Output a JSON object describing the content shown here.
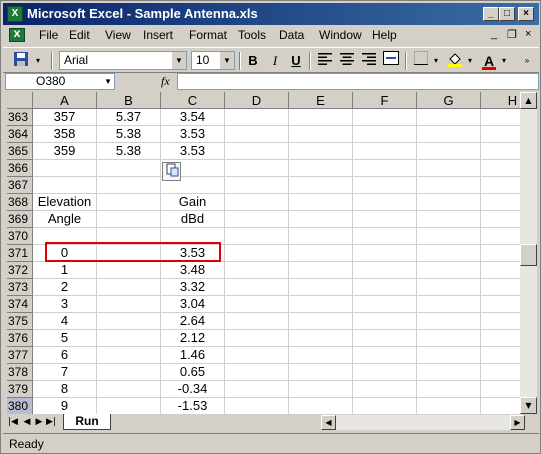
{
  "window": {
    "title": "Microsoft Excel - Sample Antenna.xls",
    "icon": "excel-app-icon",
    "controls": [
      "_",
      "□",
      "×"
    ]
  },
  "menu": {
    "items": [
      "File",
      "Edit",
      "View",
      "Insert",
      "Format",
      "Tools",
      "Data",
      "Window",
      "Help"
    ],
    "right_controls": [
      "_",
      "❐",
      "×"
    ]
  },
  "toolbar": {
    "font_name": "Arial",
    "font_size": "10",
    "bold": "B",
    "italic": "I",
    "underline": "U",
    "font_color_letter": "A"
  },
  "formula_bar": {
    "name_box": "O380",
    "fx": "fx",
    "value": ""
  },
  "grid": {
    "columns": [
      "A",
      "B",
      "C",
      "D",
      "E",
      "F",
      "G",
      "H"
    ],
    "rows": [
      {
        "num": "363",
        "A": "357",
        "B": "5.37",
        "C": "3.54"
      },
      {
        "num": "364",
        "A": "358",
        "B": "5.38",
        "C": "3.53"
      },
      {
        "num": "365",
        "A": "359",
        "B": "5.38",
        "C": "3.53"
      },
      {
        "num": "366",
        "A": "",
        "B": "",
        "C": ""
      },
      {
        "num": "367",
        "A": "",
        "B": "",
        "C": ""
      },
      {
        "num": "368",
        "A": "Elevation",
        "B": "",
        "C": "Gain"
      },
      {
        "num": "369",
        "A": "Angle",
        "B": "",
        "C": "dBd"
      },
      {
        "num": "370",
        "A": "",
        "B": "",
        "C": ""
      },
      {
        "num": "371",
        "A": "0",
        "B": "",
        "C": "3.53"
      },
      {
        "num": "372",
        "A": "1",
        "B": "",
        "C": "3.48"
      },
      {
        "num": "373",
        "A": "2",
        "B": "",
        "C": "3.32"
      },
      {
        "num": "374",
        "A": "3",
        "B": "",
        "C": "3.04"
      },
      {
        "num": "375",
        "A": "4",
        "B": "",
        "C": "2.64"
      },
      {
        "num": "376",
        "A": "5",
        "B": "",
        "C": "2.12"
      },
      {
        "num": "377",
        "A": "6",
        "B": "",
        "C": "1.46"
      },
      {
        "num": "378",
        "A": "7",
        "B": "",
        "C": "0.65"
      },
      {
        "num": "379",
        "A": "8",
        "B": "",
        "C": "-0.34"
      },
      {
        "num": "380",
        "A": "9",
        "B": "",
        "C": "-1.53"
      }
    ],
    "active_row": "380",
    "highlight_color": "#e00000"
  },
  "sheet_tabs": {
    "active": "Run"
  },
  "status": {
    "text": "Ready"
  }
}
